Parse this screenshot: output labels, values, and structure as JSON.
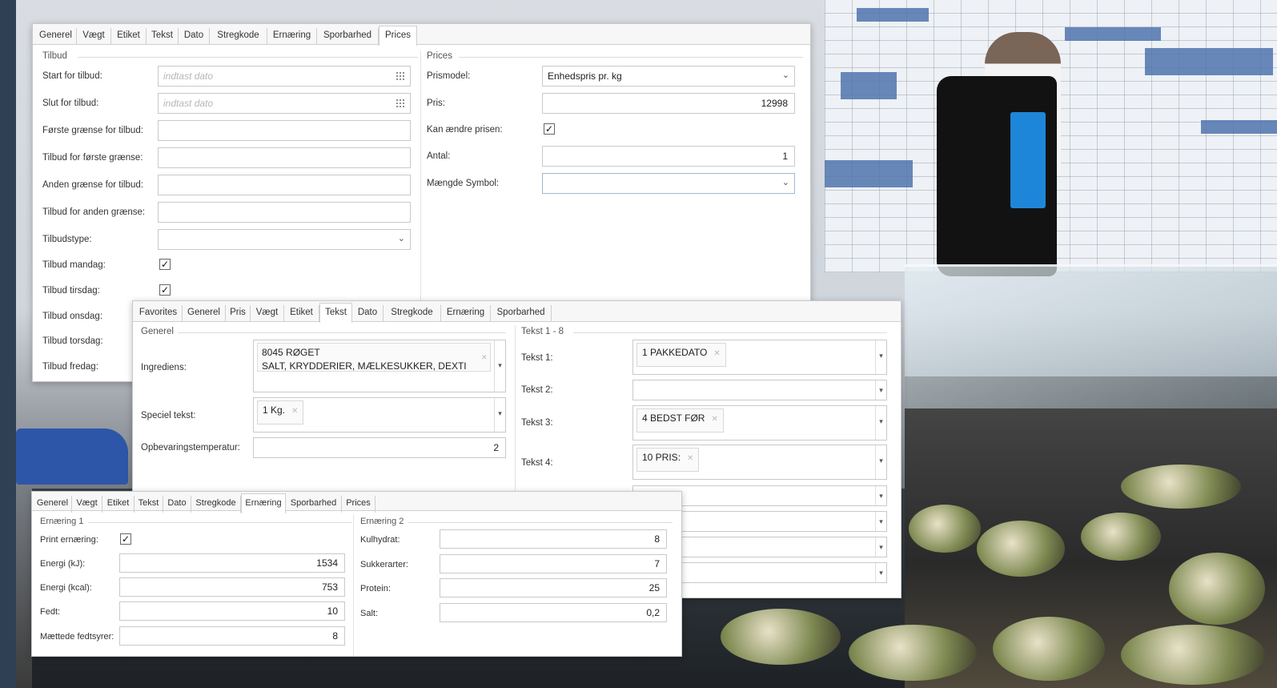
{
  "win_prices": {
    "tabs": [
      "Generel",
      "Vægt",
      "Etiket",
      "Tekst",
      "Dato",
      "Stregkode",
      "Ernæring",
      "Sporbarhed",
      "Prices"
    ],
    "active_tab": "Prices",
    "tilbud": {
      "group_title": "Tilbud",
      "start_label": "Start for tilbud:",
      "start_placeholder": "indtast dato",
      "slut_label": "Slut for tilbud:",
      "slut_placeholder": "indtast dato",
      "forste_graense_label": "Første grænse for tilbud:",
      "tilbud_forste_label": "Tilbud for første grænse:",
      "anden_graense_label": "Anden grænse for tilbud:",
      "tilbud_anden_label": "Tilbud for anden grænse:",
      "tilbudstype_label": "Tilbudstype:",
      "mandag_label": "Tilbud mandag:",
      "tirsdag_label": "Tilbud tirsdag:",
      "onsdag_label": "Tilbud onsdag:",
      "torsdag_label": "Tilbud torsdag:",
      "fredag_label": "Tilbud fredag:"
    },
    "prices": {
      "group_title": "Prices",
      "prismodel_label": "Prismodel:",
      "prismodel_value": "Enhedspris pr. kg",
      "pris_label": "Pris:",
      "pris_value": "12998",
      "kan_aendre_label": "Kan ændre prisen:",
      "kan_aendre_checked": true,
      "antal_label": "Antal:",
      "antal_value": "1",
      "maengde_label": "Mængde Symbol:",
      "maengde_value": ""
    }
  },
  "win_tekst": {
    "tabs": [
      "Favorites",
      "Generel",
      "Pris",
      "Vægt",
      "Etiket",
      "Tekst",
      "Dato",
      "Stregkode",
      "Ernæring",
      "Sporbarhed"
    ],
    "active_tab": "Tekst",
    "generel": {
      "group_title": "Generel",
      "ingrediens_label": "Ingrediens:",
      "ingrediens_line1": "8045 RØGET",
      "ingrediens_line2": "SALT, KRYDDERIER, MÆLKESUKKER, DEXTI",
      "speciel_label": "Speciel tekst:",
      "speciel_chip": "1 Kg.",
      "opbevaring_label": "Opbevaringstemperatur:",
      "opbevaring_value": "2"
    },
    "tekst18": {
      "group_title": "Tekst 1 - 8",
      "t1_label": "Tekst 1:",
      "t1_chip": "1 PAKKEDATO",
      "t2_label": "Tekst 2:",
      "t3_label": "Tekst 3:",
      "t3_chip": "4 BEDST FØR",
      "t4_label": "Tekst 4:",
      "t4_chip": "10 PRIS:"
    }
  },
  "win_ernaering": {
    "tabs": [
      "Generel",
      "Vægt",
      "Etiket",
      "Tekst",
      "Dato",
      "Stregkode",
      "Ernæring",
      "Sporbarhed",
      "Prices"
    ],
    "active_tab": "Ernæring",
    "ern1": {
      "group_title": "Ernæring 1",
      "print_label": "Print ernæring:",
      "print_checked": true,
      "energi_kj_label": "Energi (kJ):",
      "energi_kj_value": "1534",
      "energi_kcal_label": "Energi (kcal):",
      "energi_kcal_value": "753",
      "fedt_label": "Fedt:",
      "fedt_value": "10",
      "maettede_label": "Mættede fedtsyrer:",
      "maettede_value": "8"
    },
    "ern2": {
      "group_title": "Ernæring 2",
      "kulhydrat_label": "Kulhydrat:",
      "kulhydrat_value": "8",
      "sukker_label": "Sukkerarter:",
      "sukker_value": "7",
      "protein_label": "Protein:",
      "protein_value": "25",
      "salt_label": "Salt:",
      "salt_value": "0,2"
    }
  },
  "icons": {
    "calendar": "calendar-icon",
    "dropdown": "chevron-down-icon",
    "remove": "close-icon",
    "check": "✓"
  },
  "colors": {
    "window_bg": "#ffffff",
    "border": "#c9c9c9",
    "tile_blue": "#4f74ad",
    "kiosk_screen": "#1e86d8"
  }
}
